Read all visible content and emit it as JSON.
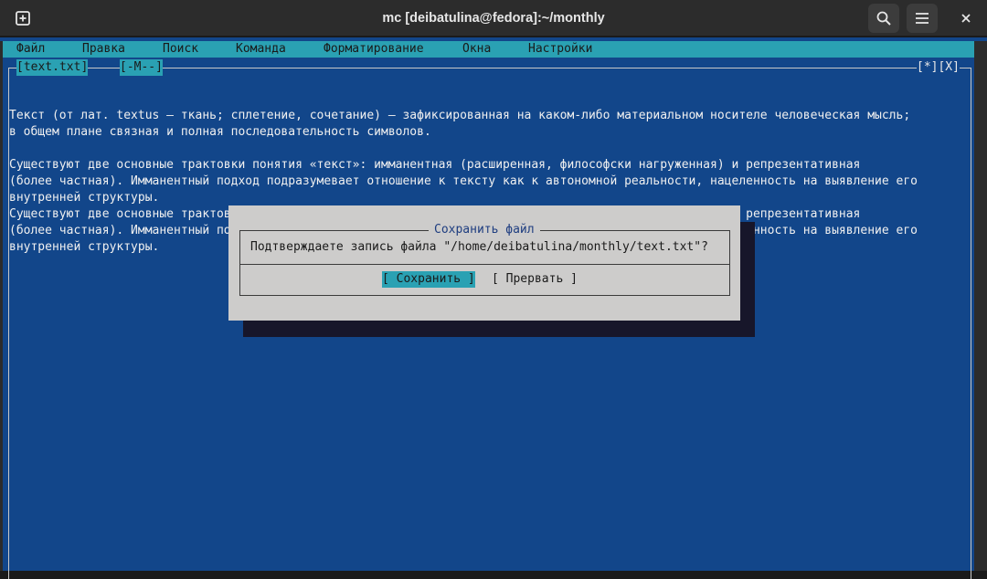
{
  "window": {
    "title": "mc [deibatulina@fedora]:~/monthly"
  },
  "menu": [
    {
      "label": "Файл"
    },
    {
      "label": "Правка"
    },
    {
      "label": "Поиск"
    },
    {
      "label": "Команда"
    },
    {
      "label": "Форматирование"
    },
    {
      "label": "Окна"
    },
    {
      "label": "Настройки"
    }
  ],
  "editor": {
    "filename_tag": "[text.txt]",
    "modified_tag": "[-M--]",
    "window_controls": "[*][X]",
    "lines": [
      "Текст (от лат. textus — ткань; сплетение, сочетание) — зафиксированная на каком-либо материальном носителе человеческая мысль;",
      "в общем плане связная и полная последовательность символов.",
      "",
      "Существуют две основные трактовки понятия «текст»: имманентная (расширенная, философски нагруженная) и репрезентативная",
      "(более частная). Имманентный подход подразумевает отношение к тексту как к автономной реальности, нацеленность на выявление его",
      "внутренней структуры.",
      "Существуют две основные трактовки понятия «текст»: имманентная (расширенная, философски нагруженная) и репрезентативная",
      "(более частная). Имманентный подход подразумевает отношение к тексту как к автономной реальности, нацеленность на выявление его",
      "внутренней структуры."
    ]
  },
  "dialog": {
    "title": "Сохранить файл",
    "message": "Подтверждаете запись файла \"/home/deibatulina/monthly/text.txt\"?",
    "save_label": "[ Сохранить ]",
    "abort_label": "[ Прервать ]"
  },
  "colors": {
    "terminal_bg": "#12468a",
    "menubar_bg": "#2aa1b3",
    "dialog_bg": "#cdcccb",
    "dialog_title": "#1e3d80"
  },
  "icons": [
    "new-tab-icon",
    "search-icon",
    "hamburger-menu-icon",
    "close-icon"
  ]
}
